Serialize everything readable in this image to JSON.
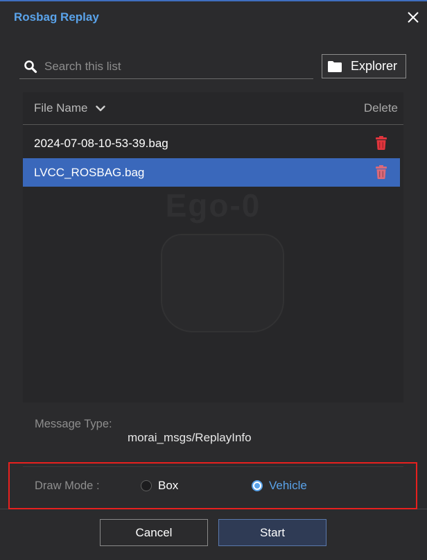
{
  "window": {
    "title": "Rosbag Replay",
    "close_icon": "close-icon"
  },
  "search": {
    "icon": "search-icon",
    "placeholder": "Search this list"
  },
  "explorer_button": {
    "icon": "folder-icon",
    "label": "Explorer"
  },
  "file_list": {
    "columns": {
      "name": "File Name",
      "delete": "Delete"
    },
    "sort_icon": "chevron-down-icon",
    "rows": [
      {
        "name": "2024-07-08-10-53-39.bag",
        "selected": false,
        "delete_icon": "trash-icon"
      },
      {
        "name": "LVCC_ROSBAG.bag",
        "selected": true,
        "delete_icon": "trash-icon"
      }
    ]
  },
  "background": {
    "vehicle_label": "Ego-0"
  },
  "message_type": {
    "label": "Message Type:",
    "value": "morai_msgs/ReplayInfo"
  },
  "draw_mode": {
    "label": "Draw Mode :",
    "options": [
      {
        "label": "Box",
        "checked": false
      },
      {
        "label": "Vehicle",
        "checked": true
      }
    ]
  },
  "actions": {
    "cancel_label": "Cancel",
    "start_label": "Start"
  },
  "colors": {
    "accent": "#5aa3ea",
    "selected_row": "#3a68bb",
    "delete_icon": "#e0353d",
    "highlight_box": "#e8201e"
  }
}
